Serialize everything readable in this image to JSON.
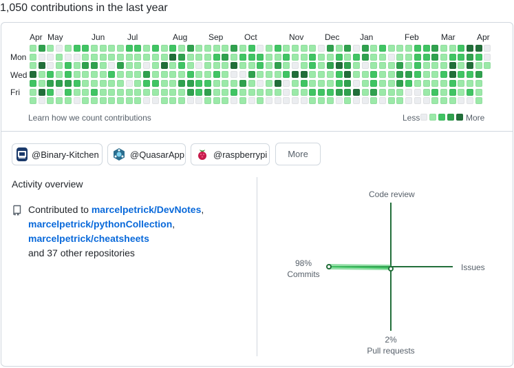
{
  "heading": "1,050 contributions in the last year",
  "calendar": {
    "months": [
      "Apr",
      "May",
      "Jun",
      "Jul",
      "Aug",
      "Sep",
      "Oct",
      "Nov",
      "Dec",
      "Jan",
      "Feb",
      "Mar",
      "Apr"
    ],
    "days": [
      "Mon",
      "Wed",
      "Fri"
    ],
    "learn_link": "Learn how we count contributions",
    "legend_less": "Less",
    "legend_more": "More",
    "colors": [
      "#ebedf0",
      "#9be9a8",
      "#40c463",
      "#30a14e",
      "#216e39"
    ]
  },
  "orgs": [
    {
      "label": "@Binary-Kitchen",
      "icon": "binary-kitchen-avatar"
    },
    {
      "label": "@QuasarApp",
      "icon": "quasarapp-avatar"
    },
    {
      "label": "@raspberrypi",
      "icon": "raspberry-pi-avatar"
    }
  ],
  "more_button": "More",
  "activity": {
    "title": "Activity overview",
    "contributed_prefix": "Contributed to",
    "repos": [
      "marcelpetrick/DevNotes",
      "marcelpetrick/pythonCollection",
      "marcelpetrick/cheatsheets"
    ],
    "others": "and 37 other repositories"
  },
  "radar": {
    "code_review": "Code review",
    "issues": "Issues",
    "commits_pct": "98%",
    "commits": "Commits",
    "pull_requests_pct": "2%",
    "pull_requests": "Pull requests",
    "accent": "#216e39",
    "fill": "#40c463"
  }
}
